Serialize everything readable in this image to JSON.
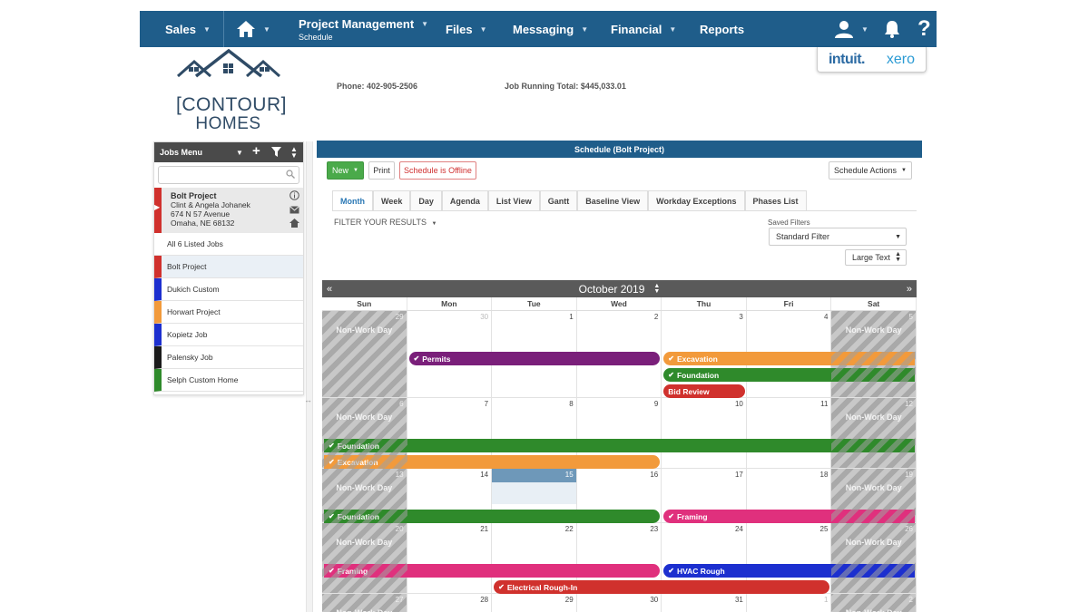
{
  "nav": {
    "sales": "Sales",
    "project_management": "Project Management",
    "project_management_sub": "Schedule",
    "files": "Files",
    "messaging": "Messaging",
    "financial": "Financial",
    "reports": "Reports",
    "help": "?"
  },
  "logo": {
    "line1": "[CONTOUR]",
    "line2": "HOMES"
  },
  "header": {
    "phone": "Phone: 402-905-2506",
    "job_running_total": "Job Running Total:  $445,033.01"
  },
  "integrations": {
    "intuit": "intuit.",
    "xero": "xero"
  },
  "jobs_menu": {
    "title": "Jobs Menu",
    "search_placeholder": "",
    "selected": {
      "title": "Bolt Project",
      "client": "Clint & Angela Johanek",
      "address1": "674 N 57 Avenue",
      "address2": "Omaha, NE 68132",
      "color": "#d0312d"
    },
    "all_jobs": "All 6 Listed Jobs",
    "jobs": [
      {
        "name": "Bolt Project",
        "color": "#d0312d"
      },
      {
        "name": "Dukich Custom",
        "color": "#1c2fcf"
      },
      {
        "name": "Horwart Project",
        "color": "#f29a3b"
      },
      {
        "name": "Kopietz Job",
        "color": "#1c2fcf"
      },
      {
        "name": "Palensky Job",
        "color": "#1a1a1a"
      },
      {
        "name": "Selph Custom Home",
        "color": "#2f8a2b"
      }
    ]
  },
  "schedule": {
    "title": "Schedule (Bolt Project)",
    "new_label": "New",
    "print_label": "Print",
    "offline_label": "Schedule is Offline",
    "actions_label": "Schedule Actions",
    "tabs": [
      "Month",
      "Week",
      "Day",
      "Agenda",
      "List View",
      "Gantt",
      "Baseline View",
      "Workday Exceptions",
      "Phases List"
    ],
    "filter_label": "FILTER YOUR RESULTS",
    "saved_filters_label": "Saved Filters",
    "saved_filter_value": "Standard Filter",
    "text_size_value": "Large Text"
  },
  "calendar": {
    "month_label": "October 2019",
    "prev": "«",
    "next": "»",
    "dow": [
      "Sun",
      "Mon",
      "Tue",
      "Wed",
      "Thu",
      "Fri",
      "Sat"
    ],
    "non_work_label": "Non-Work Day",
    "weeks": [
      {
        "days": [
          "29",
          "30",
          "1",
          "2",
          "3",
          "4",
          "5"
        ]
      },
      {
        "days": [
          "6",
          "7",
          "8",
          "9",
          "10",
          "11",
          "12"
        ]
      },
      {
        "days": [
          "13",
          "14",
          "15",
          "16",
          "17",
          "18",
          "19"
        ]
      },
      {
        "days": [
          "20",
          "21",
          "22",
          "23",
          "24",
          "25",
          "26"
        ]
      },
      {
        "days": [
          "27",
          "28",
          "29",
          "30",
          "31",
          "1",
          "2"
        ]
      }
    ],
    "today": "15",
    "events": [
      {
        "week": 0,
        "label": "Permits",
        "color": "#7a1f7a",
        "start": 1,
        "end": 4,
        "row": 0,
        "check": true
      },
      {
        "week": 0,
        "label": "Excavation",
        "color": "#f29a3b",
        "start": 4,
        "end": 7,
        "row": 0,
        "check": true
      },
      {
        "week": 0,
        "label": "Foundation",
        "color": "#2f8a2b",
        "start": 4,
        "end": 7,
        "row": 1,
        "check": true
      },
      {
        "week": 0,
        "label": "Bid Review",
        "color": "#d0312d",
        "start": 4,
        "end": 5,
        "row": 2,
        "check": false
      },
      {
        "week": 1,
        "label": "Foundation",
        "color": "#2f8a2b",
        "start": 0,
        "end": 7,
        "row": 0,
        "check": true
      },
      {
        "week": 1,
        "label": "Excavation",
        "color": "#f29a3b",
        "start": 0,
        "end": 4,
        "row": 1,
        "check": true
      },
      {
        "week": 2,
        "label": "Foundation",
        "color": "#2f8a2b",
        "start": 0,
        "end": 4,
        "row": 0,
        "check": true
      },
      {
        "week": 2,
        "label": "Framing",
        "color": "#e0307d",
        "start": 4,
        "end": 7,
        "row": 0,
        "check": true
      },
      {
        "week": 3,
        "label": "Framing",
        "color": "#e0307d",
        "start": 0,
        "end": 4,
        "row": 0,
        "check": true
      },
      {
        "week": 3,
        "label": "HVAC Rough",
        "color": "#1c2fcf",
        "start": 4,
        "end": 7,
        "row": 0,
        "check": true
      },
      {
        "week": 3,
        "label": "Electrical Rough-In",
        "color": "#d0312d",
        "start": 2,
        "end": 6,
        "row": 1,
        "check": true
      }
    ]
  }
}
